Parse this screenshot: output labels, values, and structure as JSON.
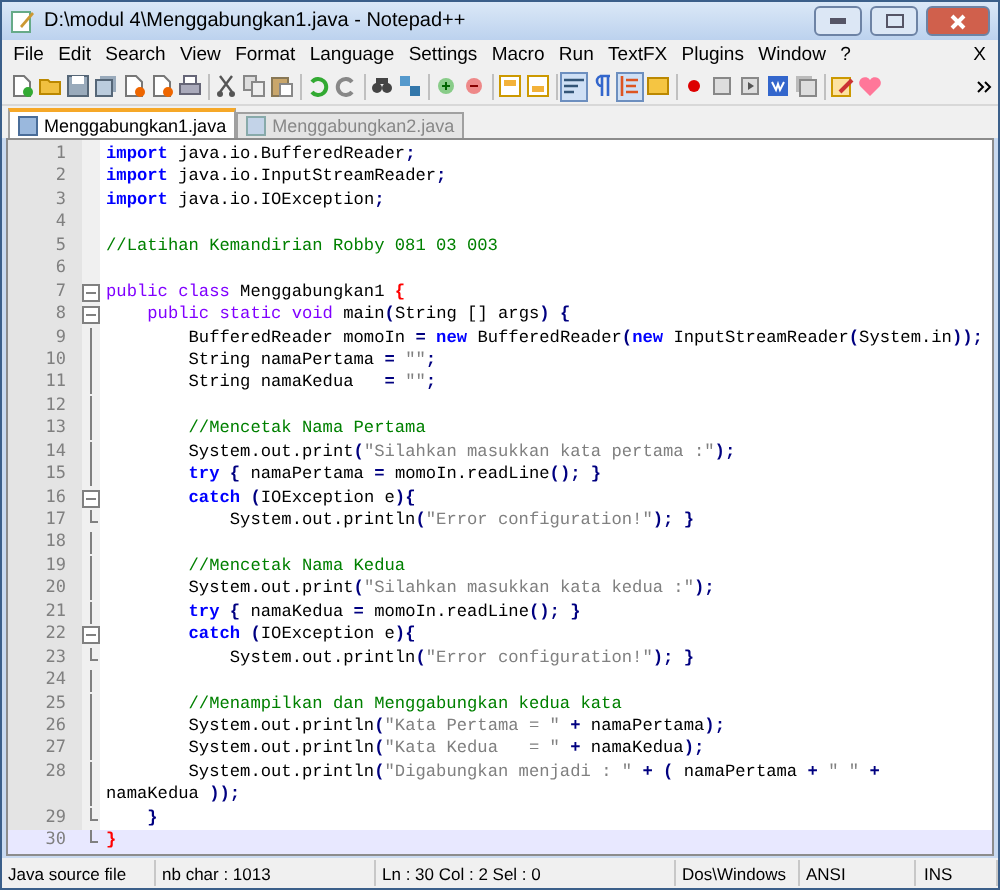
{
  "window": {
    "title": "D:\\modul 4\\Menggabungkan1.java - Notepad++"
  },
  "menu": [
    "File",
    "Edit",
    "Search",
    "View",
    "Format",
    "Language",
    "Settings",
    "Macro",
    "Run",
    "TextFX",
    "Plugins",
    "Window",
    "?"
  ],
  "menu_close": "X",
  "toolbar_toggles": {
    "word_wrap": {
      "on": true
    },
    "show_all_characters": {
      "on": false
    },
    "indent_guide": {
      "on": true
    }
  },
  "tabs": [
    {
      "label": "Menggabungkan1.java",
      "selected": true
    },
    {
      "label": "Menggabungkan2.java",
      "selected": false
    }
  ],
  "editor": {
    "lines": [
      {
        "number": "1",
        "tokens": [
          {
            "kind": "kw",
            "text": "import"
          },
          {
            "kind": "txt",
            "text": " java.io.BufferedReader"
          },
          {
            "kind": "op",
            "text": ";"
          }
        ]
      },
      {
        "number": "2",
        "tokens": [
          {
            "kind": "kw",
            "text": "import"
          },
          {
            "kind": "txt",
            "text": " java.io.InputStreamReader"
          },
          {
            "kind": "op",
            "text": ";"
          }
        ]
      },
      {
        "number": "3",
        "tokens": [
          {
            "kind": "kw",
            "text": "import"
          },
          {
            "kind": "txt",
            "text": " java.io.IOException"
          },
          {
            "kind": "op",
            "text": ";"
          }
        ]
      },
      {
        "number": "4"
      },
      {
        "number": "5",
        "tokens": [
          {
            "kind": "cm",
            "text": "//Latihan Kemandirian Robby 081 03 003"
          }
        ]
      },
      {
        "number": "6"
      },
      {
        "number": "7",
        "fold_open": true,
        "tokens": [
          {
            "kind": "kw2",
            "text": "public class"
          },
          {
            "kind": "txt",
            "text": " Menggabungkan1 "
          },
          {
            "kind": "brace",
            "text": "{"
          }
        ]
      },
      {
        "number": "8",
        "fold_open": true,
        "tokens": [
          {
            "kind": "kw2",
            "text": "    public static void"
          },
          {
            "kind": "txt",
            "text": " main"
          },
          {
            "kind": "op",
            "text": "("
          },
          {
            "kind": "txt",
            "text": "String [] args"
          },
          {
            "kind": "op",
            "text": ") {"
          }
        ]
      },
      {
        "number": "9",
        "tokens": [
          {
            "kind": "txt",
            "text": "        BufferedReader momoIn "
          },
          {
            "kind": "op",
            "text": "= "
          },
          {
            "kind": "kw",
            "text": "new"
          },
          {
            "kind": "txt",
            "text": " BufferedReader"
          },
          {
            "kind": "op",
            "text": "("
          },
          {
            "kind": "kw",
            "text": "new"
          },
          {
            "kind": "txt",
            "text": " InputStreamReader"
          },
          {
            "kind": "op",
            "text": "("
          },
          {
            "kind": "txt",
            "text": "System.in"
          },
          {
            "kind": "op",
            "text": "));"
          }
        ]
      },
      {
        "number": "10",
        "tokens": [
          {
            "kind": "txt",
            "text": "        String namaPertama "
          },
          {
            "kind": "op",
            "text": "= "
          },
          {
            "kind": "str",
            "text": "\"\""
          },
          {
            "kind": "op",
            "text": ";"
          }
        ]
      },
      {
        "number": "11",
        "tokens": [
          {
            "kind": "txt",
            "text": "        String namaKedua   "
          },
          {
            "kind": "op",
            "text": "= "
          },
          {
            "kind": "str",
            "text": "\"\""
          },
          {
            "kind": "op",
            "text": ";"
          }
        ]
      },
      {
        "number": "12"
      },
      {
        "number": "13",
        "tokens": [
          {
            "kind": "cm",
            "text": "        //Mencetak Nama Pertama"
          }
        ]
      },
      {
        "number": "14",
        "tokens": [
          {
            "kind": "txt",
            "text": "        System.out.print"
          },
          {
            "kind": "op",
            "text": "("
          },
          {
            "kind": "str",
            "text": "\"Silahkan masukkan kata pertama :\""
          },
          {
            "kind": "op",
            "text": ");"
          }
        ]
      },
      {
        "number": "15",
        "tokens": [
          {
            "kind": "kw",
            "text": "        try"
          },
          {
            "kind": "op",
            "text": " { "
          },
          {
            "kind": "txt",
            "text": "namaPertama "
          },
          {
            "kind": "op",
            "text": "= "
          },
          {
            "kind": "txt",
            "text": "momoIn.readLine"
          },
          {
            "kind": "op",
            "text": "(); }"
          }
        ]
      },
      {
        "number": "16",
        "fold_open": true,
        "tokens": [
          {
            "kind": "kw",
            "text": "        catch"
          },
          {
            "kind": "op",
            "text": " ("
          },
          {
            "kind": "txt",
            "text": "IOException e"
          },
          {
            "kind": "op",
            "text": "){"
          }
        ]
      },
      {
        "number": "17",
        "fold_end": true,
        "tokens": [
          {
            "kind": "txt",
            "text": "            System.out.println"
          },
          {
            "kind": "op",
            "text": "("
          },
          {
            "kind": "str",
            "text": "\"Error configuration!\""
          },
          {
            "kind": "op",
            "text": "); }"
          }
        ]
      },
      {
        "number": "18"
      },
      {
        "number": "19",
        "tokens": [
          {
            "kind": "cm",
            "text": "        //Mencetak Nama Kedua"
          }
        ]
      },
      {
        "number": "20",
        "tokens": [
          {
            "kind": "txt",
            "text": "        System.out.print"
          },
          {
            "kind": "op",
            "text": "("
          },
          {
            "kind": "str",
            "text": "\"Silahkan masukkan kata kedua :\""
          },
          {
            "kind": "op",
            "text": ");"
          }
        ]
      },
      {
        "number": "21",
        "tokens": [
          {
            "kind": "kw",
            "text": "        try"
          },
          {
            "kind": "op",
            "text": " { "
          },
          {
            "kind": "txt",
            "text": "namaKedua "
          },
          {
            "kind": "op",
            "text": "= "
          },
          {
            "kind": "txt",
            "text": "momoIn.readLine"
          },
          {
            "kind": "op",
            "text": "(); }"
          }
        ]
      },
      {
        "number": "22",
        "fold_open": true,
        "tokens": [
          {
            "kind": "kw",
            "text": "        catch"
          },
          {
            "kind": "op",
            "text": " ("
          },
          {
            "kind": "txt",
            "text": "IOException e"
          },
          {
            "kind": "op",
            "text": "){"
          }
        ]
      },
      {
        "number": "23",
        "fold_end": true,
        "tokens": [
          {
            "kind": "txt",
            "text": "            System.out.println"
          },
          {
            "kind": "op",
            "text": "("
          },
          {
            "kind": "str",
            "text": "\"Error configuration!\""
          },
          {
            "kind": "op",
            "text": "); }"
          }
        ]
      },
      {
        "number": "24"
      },
      {
        "number": "25",
        "tokens": [
          {
            "kind": "cm",
            "text": "        //Menampilkan dan Menggabungkan kedua kata"
          }
        ]
      },
      {
        "number": "26",
        "tokens": [
          {
            "kind": "txt",
            "text": "        System.out.println"
          },
          {
            "kind": "op",
            "text": "("
          },
          {
            "kind": "str",
            "text": "\"Kata Pertama = \""
          },
          {
            "kind": "op",
            "text": " + "
          },
          {
            "kind": "txt",
            "text": "namaPertama"
          },
          {
            "kind": "op",
            "text": ");"
          }
        ]
      },
      {
        "number": "27",
        "tokens": [
          {
            "kind": "txt",
            "text": "        System.out.println"
          },
          {
            "kind": "op",
            "text": "("
          },
          {
            "kind": "str",
            "text": "\"Kata Kedua   = \""
          },
          {
            "kind": "op",
            "text": " + "
          },
          {
            "kind": "txt",
            "text": "namaKedua"
          },
          {
            "kind": "op",
            "text": ");"
          }
        ]
      },
      {
        "number": "28",
        "tokens": [
          {
            "kind": "txt",
            "text": "        System.out.println"
          },
          {
            "kind": "op",
            "text": "("
          },
          {
            "kind": "str",
            "text": "\"Digabungkan menjadi : \""
          },
          {
            "kind": "op",
            "text": " + ( "
          },
          {
            "kind": "txt",
            "text": "namaPertama "
          },
          {
            "kind": "op",
            "text": "+ "
          },
          {
            "kind": "str",
            "text": "\" \""
          },
          {
            "kind": "op",
            "text": " +"
          }
        ],
        "wrap": [
          {
            "kind": "txt",
            "text": "namaKedua "
          },
          {
            "kind": "op",
            "text": "));"
          }
        ]
      },
      {
        "number": "29",
        "fold_end": true,
        "tokens": [
          {
            "kind": "op",
            "text": "    }"
          }
        ]
      },
      {
        "number": "30",
        "fold_end": true,
        "current": true,
        "tokens": [
          {
            "kind": "brace",
            "text": "}"
          }
        ]
      }
    ]
  },
  "status_bar": [
    "Java source file",
    "nb char : 1013",
    "Ln : 30    Col : 2    Sel : 0",
    "Dos\\Windows",
    "ANSI",
    "INS"
  ]
}
